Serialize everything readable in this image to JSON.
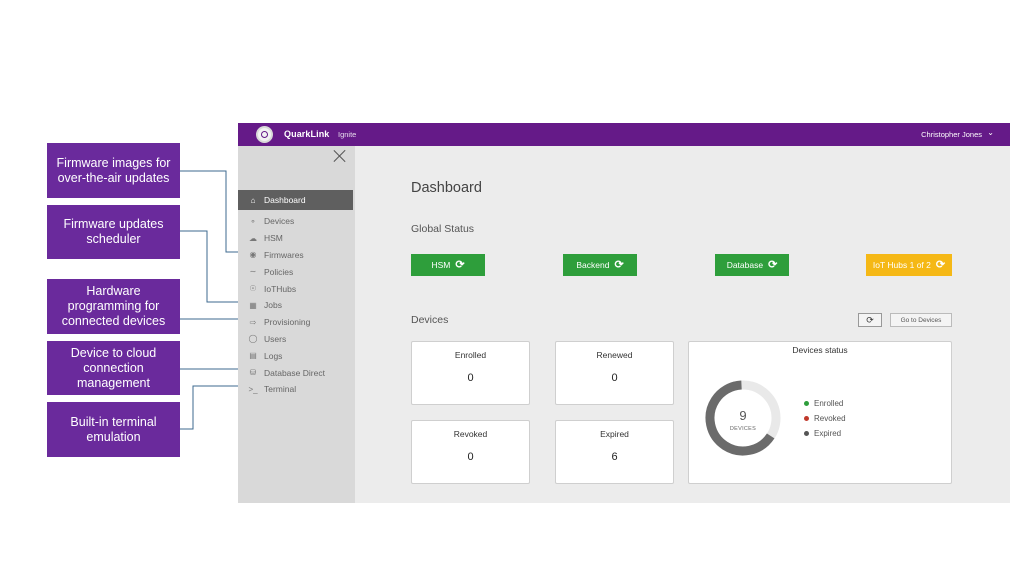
{
  "callouts": [
    {
      "text": "Firmware images for over-the-air updates"
    },
    {
      "text": "Firmware updates scheduler"
    },
    {
      "text": "Hardware programming for connected devices"
    },
    {
      "text": "Device to cloud connection management"
    },
    {
      "text": "Built-in terminal emulation"
    }
  ],
  "app": {
    "brand": "QuarkLink",
    "brand_sub": "Ignite",
    "user": "Christopher Jones",
    "user_chevron_icon": "chevron-down-icon"
  },
  "sidebar": {
    "close_icon": "close-icon",
    "items": [
      {
        "label": "Dashboard",
        "icon": "home-icon",
        "active": true
      },
      {
        "label": "Devices",
        "icon": "devices-icon"
      },
      {
        "label": "HSM",
        "icon": "cloud-icon"
      },
      {
        "label": "Firmwares",
        "icon": "firmware-icon"
      },
      {
        "label": "Policies",
        "icon": "policy-icon"
      },
      {
        "label": "IoTHubs",
        "icon": "hub-icon"
      },
      {
        "label": "Jobs",
        "icon": "calendar-icon"
      },
      {
        "label": "Provisioning",
        "icon": "provision-icon"
      },
      {
        "label": "Users",
        "icon": "users-icon"
      },
      {
        "label": "Logs",
        "icon": "logs-icon"
      },
      {
        "label": "Database Direct",
        "icon": "database-icon"
      },
      {
        "label": "Terminal",
        "icon": "terminal-icon"
      }
    ]
  },
  "main": {
    "title": "Dashboard",
    "global_status": {
      "title": "Global Status",
      "buttons": [
        {
          "label": "HSM",
          "color": "#2e9e3b"
        },
        {
          "label": "Backend",
          "color": "#2e9e3b"
        },
        {
          "label": "Database",
          "color": "#2e9e3b"
        },
        {
          "label": "IoT Hubs 1 of 2",
          "color": "#f5b816"
        }
      ],
      "refresh_icon": "refresh-icon"
    },
    "devices": {
      "title": "Devices",
      "refresh_icon": "refresh-icon",
      "goto_label": "Go to Devices",
      "cards": [
        {
          "label": "Enrolled",
          "value": "0"
        },
        {
          "label": "Renewed",
          "value": "0"
        },
        {
          "label": "Revoked",
          "value": "0"
        },
        {
          "label": "Expired",
          "value": "6"
        }
      ],
      "status": {
        "title": "Devices status",
        "count": "9",
        "count_label": "DEVICES",
        "legend": [
          {
            "label": "Enrolled",
            "color": "#2e9e3b"
          },
          {
            "label": "Revoked",
            "color": "#c0392b"
          },
          {
            "label": "Expired",
            "color": "#555555"
          }
        ],
        "donut_fill_fraction": 0.65
      }
    }
  }
}
